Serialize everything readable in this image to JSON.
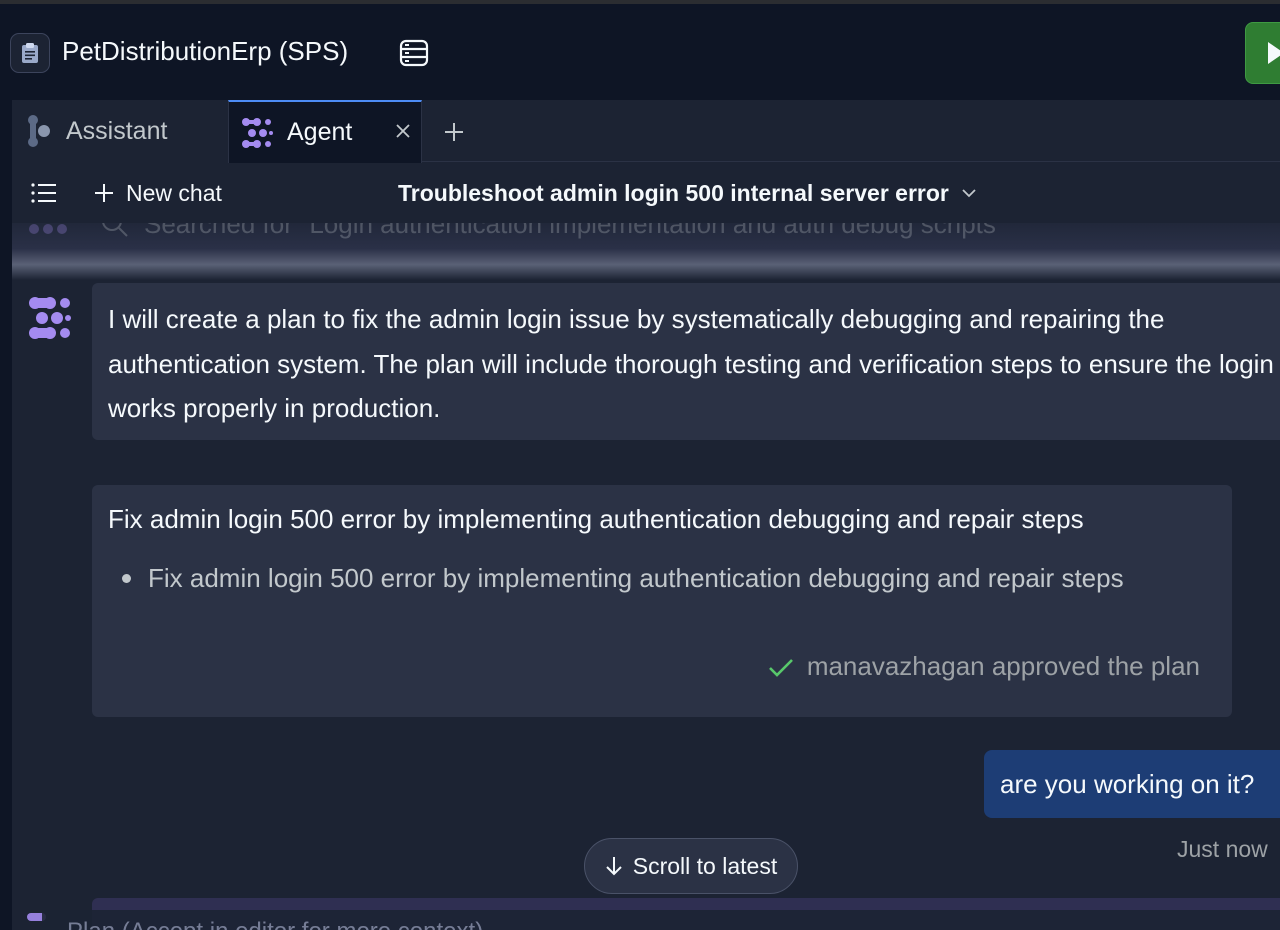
{
  "app": {
    "title": "PetDistributionErp (SPS)"
  },
  "tabs": [
    {
      "label": "Assistant",
      "icon": "assistant-icon"
    },
    {
      "label": "Agent",
      "icon": "agent-icon"
    }
  ],
  "chatbar": {
    "new_chat_label": "New chat",
    "chat_title": "Troubleshoot admin login 500 internal server error"
  },
  "history": {
    "faded_search": "Searched for \"Login authentication implementation and auth debug scripts\""
  },
  "messages": {
    "agent_message": "I will create a plan to fix the admin login issue by systematically debugging and repairing the authentication system. The plan will include thorough testing and verification steps to ensure the login works properly in production.",
    "plan": {
      "title": "Fix admin login 500 error by implementing authentication debugging and repair steps",
      "items": [
        "Fix admin login 500 error by implementing authentication debugging and repair steps"
      ],
      "approval": "manavazhagan approved the plan"
    },
    "user_message": "are you working on it?",
    "timestamp": "Just now",
    "next_card_partial": "Plan (Accept in editor for more context)"
  },
  "scroll_button": {
    "label": "Scroll to latest"
  },
  "colors": {
    "background": "#0e1525",
    "panel": "#1c2333",
    "message": "#2b3245",
    "user_bubble": "#1d3d75",
    "accent": "#4d8cf5",
    "agent_purple": "#a48bf0",
    "success": "#58c86b",
    "run_green": "#2f7d32"
  }
}
